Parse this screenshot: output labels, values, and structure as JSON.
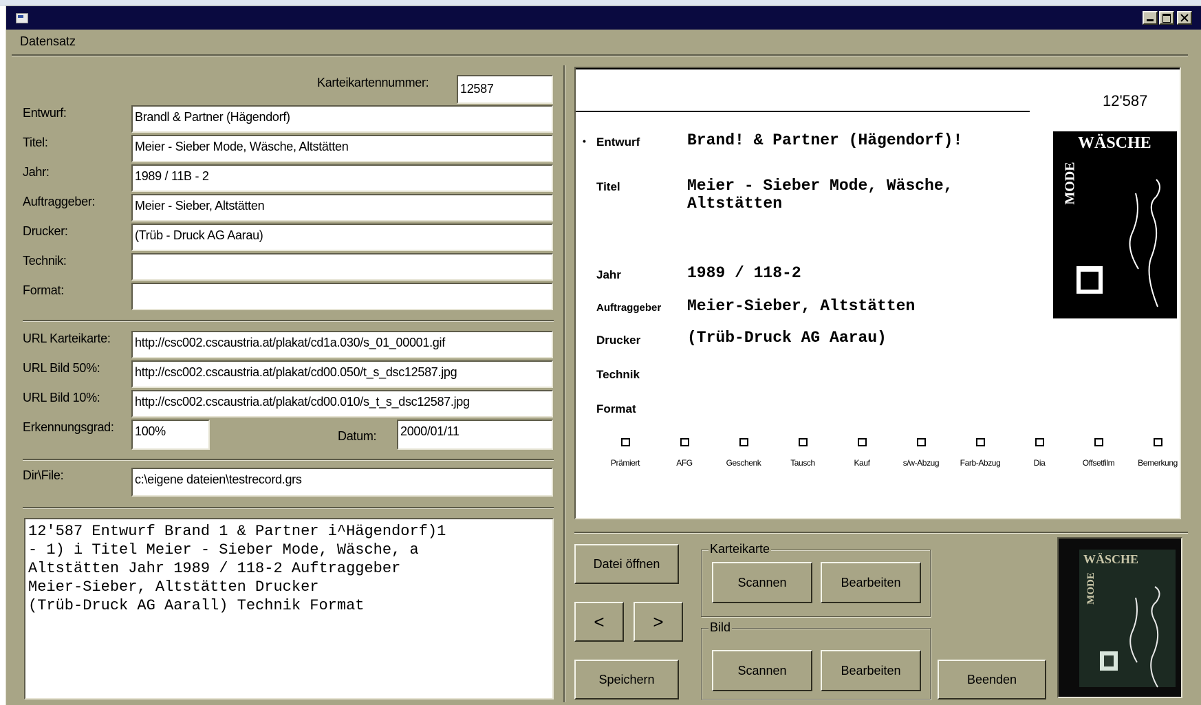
{
  "menu": {
    "datensatz": "Datensatz"
  },
  "form": {
    "karteikartennummer_label": "Karteikartennummer:",
    "karteikartennummer_value": "12587",
    "fields": [
      {
        "label": "Entwurf:",
        "value": "Brandl & Partner (Hägendorf)"
      },
      {
        "label": "Titel:",
        "value": "Meier - Sieber Mode, Wäsche,  Altstätten"
      },
      {
        "label": "Jahr:",
        "value": "1989 / 11B - 2"
      },
      {
        "label": "Auftraggeber:",
        "value": "Meier - Sieber, Altstätten"
      },
      {
        "label": "Drucker:",
        "value": "(Trüb - Druck AG Aarau)"
      },
      {
        "label": "Technik:",
        "value": ""
      },
      {
        "label": "Format:",
        "value": ""
      }
    ],
    "urls": [
      {
        "label": "URL Karteikarte:",
        "value": "http://csc002.cscaustria.at/plakat/cd1a.030/s_01_00001.gif"
      },
      {
        "label": "URL Bild 50%:",
        "value": "http://csc002.cscaustria.at/plakat/cd00.050/t_s_dsc12587.jpg"
      },
      {
        "label": "URL Bild 10%:",
        "value": "http://csc002.cscaustria.at/plakat/cd00.010/s_t_s_dsc12587.jpg"
      }
    ],
    "erkennungsgrad_label": "Erkennungsgrad:",
    "erkennungsgrad_value": "100%",
    "datum_label": "Datum:",
    "datum_value": "2000/01/11",
    "dirfile_label": "Dir\\File:",
    "dirfile_value": "c:\\eigene dateien\\testrecord.grs"
  },
  "ocr_text": [
    "12'587  Entwurf Brand 1 & Partner i^Hägendorf)1",
    "- 1) i Titel Meier - Sieber Mode, Wäsche, a",
    "Altstätten Jahr 1989 / 118-2 Auftraggeber",
    "Meier-Sieber, Altstätten        Drucker",
    "(Trüb-Druck AG Aarall) Technik Format"
  ],
  "card": {
    "number": "12'587",
    "rows": [
      {
        "label": "Entwurf",
        "value": "Brand! & Partner (Hägendorf)!"
      },
      {
        "label": "Titel",
        "value": "Meier - Sieber  Mode, Wäsche,",
        "value2": "Altstätten"
      },
      {
        "label": "Jahr",
        "value": "1989 / 118-2"
      },
      {
        "label": "Auftraggeber",
        "value": "Meier-Sieber, Altstätten"
      },
      {
        "label": "Drucker",
        "value": "(Trüb-Druck AG Aarau)"
      },
      {
        "label": "Technik",
        "value": ""
      },
      {
        "label": "Format",
        "value": ""
      }
    ],
    "checkboxes": [
      "Prämiert",
      "AFG",
      "Geschenk",
      "Tausch",
      "Kauf",
      "s/w-Abzug",
      "Farb-Abzug",
      "Dia",
      "Offsetfilm",
      "Bemerkung"
    ],
    "poster_word_top": "WÄSCHE",
    "poster_word_side": "MODE"
  },
  "buttons": {
    "datei_oeffnen": "Datei öffnen",
    "prev": "<",
    "next": ">",
    "speichern": "Speichern",
    "beenden": "Beenden"
  },
  "groups": {
    "karteikarte": {
      "title": "Karteikarte",
      "scan": "Scannen",
      "edit": "Bearbeiten"
    },
    "bild": {
      "title": "Bild",
      "scan": "Scannen",
      "edit": "Bearbeiten"
    }
  },
  "thumbnail": {
    "word_top": "WÄSCHE",
    "word_side": "MODE"
  },
  "colors": {
    "window_face": "#a8a586",
    "titlebar": "#0a0a40",
    "field_bg": "#ffffff"
  }
}
